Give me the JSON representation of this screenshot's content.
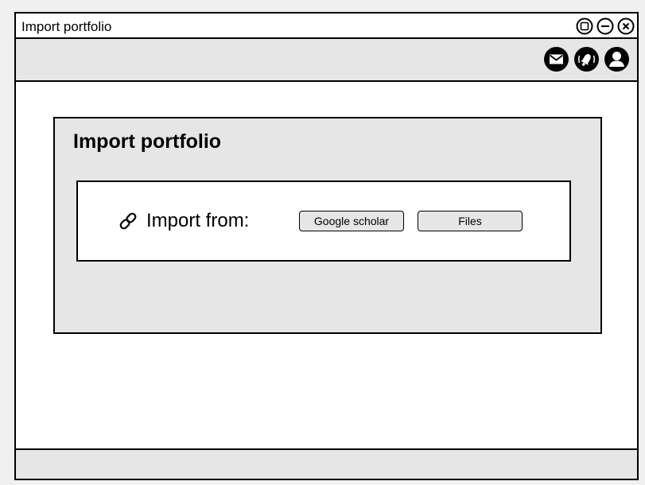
{
  "window": {
    "title": "Import portfolio",
    "controls": [
      "maximize-icon",
      "minimize-icon",
      "close-icon"
    ]
  },
  "toolbar": {
    "icons": [
      "mail-icon",
      "notification-icon",
      "user-icon"
    ]
  },
  "panel": {
    "title": "Import portfolio",
    "import_label": "Import from:",
    "link_icon": "link-icon",
    "buttons": {
      "google_scholar": "Google scholar",
      "files": "Files"
    }
  },
  "colors": {
    "panel_background": "#e6e6e6",
    "border": "#000000",
    "page_background": "#f0f0f0"
  }
}
